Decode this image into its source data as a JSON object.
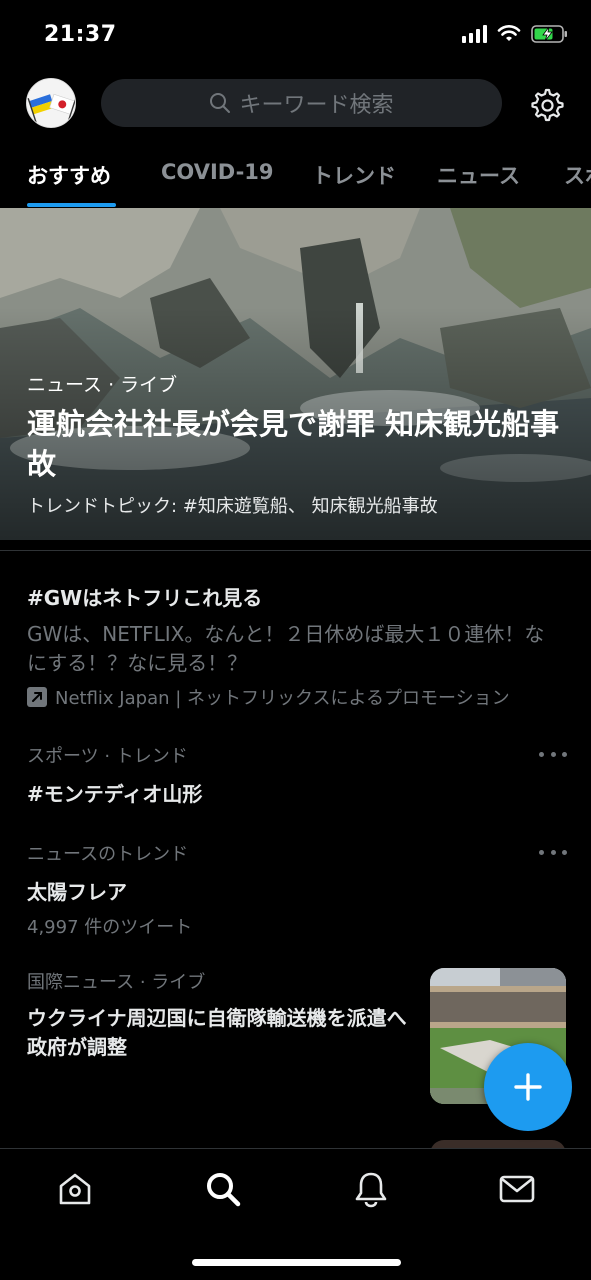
{
  "status_bar": {
    "time": "21:37",
    "icons": [
      "signal-icon",
      "wifi-icon",
      "battery-charging-icon"
    ]
  },
  "header": {
    "avatar": "avatar-flags",
    "search_placeholder": "キーワード検索",
    "icons": [
      "search-icon",
      "settings-gear-icon"
    ]
  },
  "tabs": [
    {
      "label": "おすすめ",
      "active": true
    },
    {
      "label": "COVID-19",
      "active": false
    },
    {
      "label": "トレンド",
      "active": false
    },
    {
      "label": "ニュース",
      "active": false
    },
    {
      "label": "スポ",
      "active": false
    }
  ],
  "hero": {
    "category": "ニュース · ライブ",
    "title": "運航会社社長が会見で謝罪 知床観光船事故",
    "topics": "トレンドトピック: #知床遊覧船、 知床観光船事故"
  },
  "trends": [
    {
      "title": "#GWはネトフリこれ見る",
      "description": "GWは、NETFLIX。なんと！２日休めば最大１０連休！なにする！？なに見る！？",
      "promoted_by": "Netflix Japan | ネットフリックスによるプロモーション"
    },
    {
      "category": "スポーツ · トレンド",
      "title": "#モンテディオ山形"
    },
    {
      "category": "ニュースのトレンド",
      "title": "太陽フレア",
      "count": "4,997 件のツイート"
    },
    {
      "category": "国際ニュース · ライブ",
      "title": "ウクライナ周辺国に自衛隊輸送機を派遣へ 政府が調整"
    }
  ],
  "fab": {
    "icon": "plus-icon"
  },
  "bottom_nav": [
    "home-icon",
    "search-icon",
    "notifications-bell-icon",
    "messages-envelope-icon"
  ],
  "colors": {
    "accent": "#1d9bf0",
    "background": "#000000",
    "secondary_text": "#71767b"
  }
}
